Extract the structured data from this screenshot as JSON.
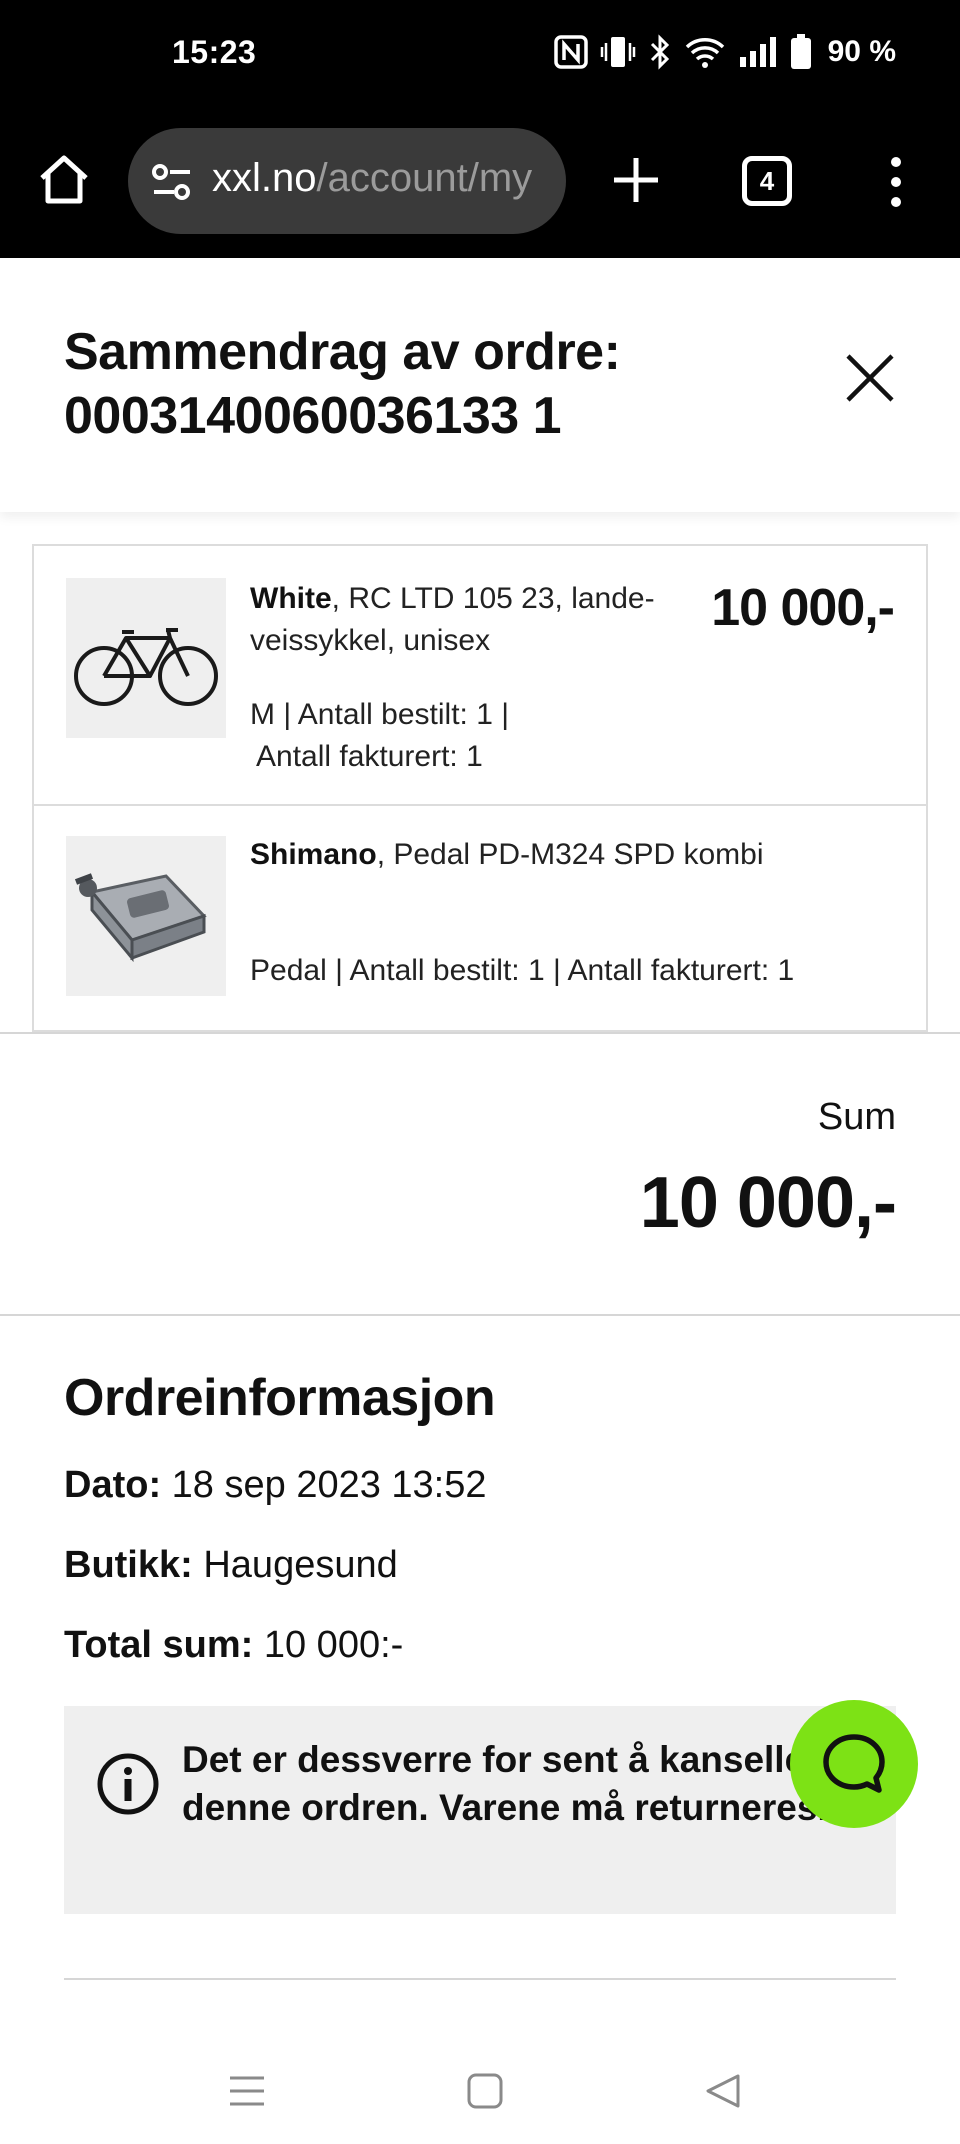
{
  "status_bar": {
    "time": "15:23",
    "battery": "90 %",
    "icons": [
      "nfc-icon",
      "vibrate-icon",
      "bluetooth-icon",
      "wifi-icon",
      "signal-icon",
      "battery-icon"
    ]
  },
  "browser": {
    "url_host": "xxl.no",
    "url_path": "/account/my",
    "tab_count": "4",
    "icons": [
      "home-icon",
      "site-settings-icon",
      "new-tab-plus-icon",
      "tab-switcher-icon",
      "more-vert-icon"
    ]
  },
  "modal": {
    "title_line1": "Sammendrag av ordre:",
    "title_line2": "0003140060036133 1",
    "close_icon": "close-icon"
  },
  "products": [
    {
      "brand": "White",
      "name": ", RC LTD 105 23, lande-veissykkel, unisex",
      "meta_line1": "M | Antall bestilt: 1 |",
      "meta_line2": "Antall fakturert: 1",
      "price": "10 000,-",
      "image": "road-bike"
    },
    {
      "brand": "Shimano",
      "name": ", Pedal PD-M324 SPD kombi",
      "meta_line1": "Pedal | Antall bestilt: 1 | Antall fakturert: 1",
      "price": "",
      "image": "pedal"
    }
  ],
  "summary": {
    "label": "Sum",
    "value": "10 000,-"
  },
  "order_info": {
    "title": "Ordreinformasjon",
    "date_label": "Dato:",
    "date_value": "18 sep 2023 13:52",
    "store_label": "Butikk:",
    "store_value": "Haugesund",
    "total_label": "Total sum:",
    "total_value": "10 000:-"
  },
  "notice": {
    "text": "Det er dessverre for sent å kansellere denne ordren. Varene må returneres.",
    "icon": "info-icon"
  },
  "chat": {
    "icon": "chat-bubble-icon",
    "color": "#7de215"
  },
  "navbar": {
    "icons": [
      "recent-apps-icon",
      "home-square-icon",
      "back-triangle-icon"
    ]
  }
}
